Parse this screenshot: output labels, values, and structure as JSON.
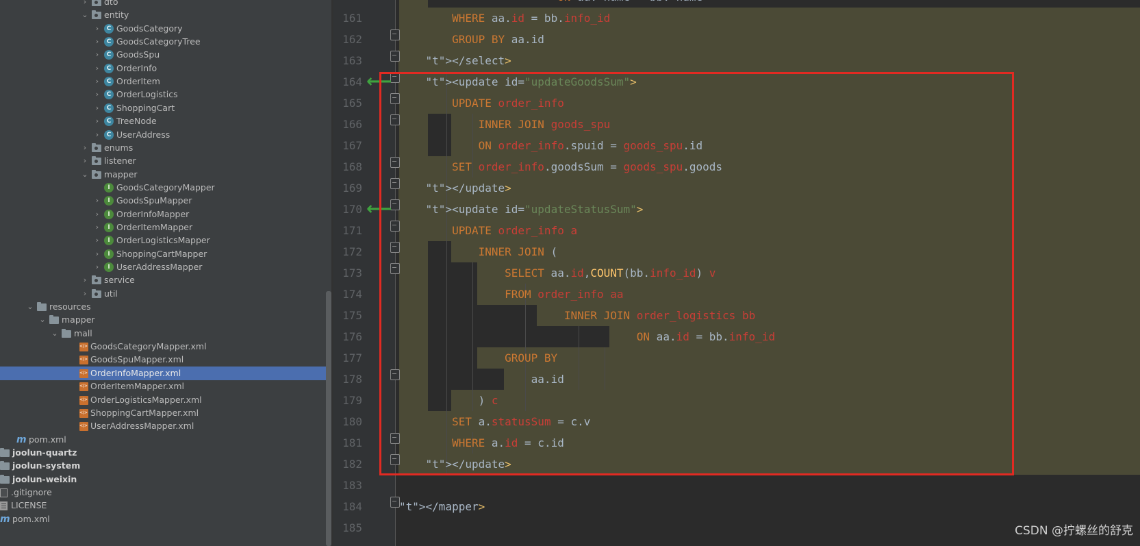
{
  "project_tree": {
    "rows": [
      {
        "label": "dto",
        "icon": "folder-icon",
        "expanded": false
      },
      {
        "label": "entity",
        "icon": "folder-icon",
        "expanded": true
      },
      {
        "label": "GoodsCategory",
        "icon": "class-icon"
      },
      {
        "label": "GoodsCategoryTree",
        "icon": "class-icon"
      },
      {
        "label": "GoodsSpu",
        "icon": "class-icon"
      },
      {
        "label": "OrderInfo",
        "icon": "class-icon"
      },
      {
        "label": "OrderItem",
        "icon": "class-icon"
      },
      {
        "label": "OrderLogistics",
        "icon": "class-icon"
      },
      {
        "label": "ShoppingCart",
        "icon": "class-icon"
      },
      {
        "label": "TreeNode",
        "icon": "class-icon"
      },
      {
        "label": "UserAddress",
        "icon": "class-icon"
      },
      {
        "label": "enums",
        "icon": "folder-icon"
      },
      {
        "label": "listener",
        "icon": "folder-icon"
      },
      {
        "label": "mapper",
        "icon": "folder-icon",
        "expanded": true
      },
      {
        "label": "GoodsCategoryMapper",
        "icon": "interface-icon"
      },
      {
        "label": "GoodsSpuMapper",
        "icon": "interface-icon"
      },
      {
        "label": "OrderInfoMapper",
        "icon": "interface-icon"
      },
      {
        "label": "OrderItemMapper",
        "icon": "interface-icon"
      },
      {
        "label": "OrderLogisticsMapper",
        "icon": "interface-icon"
      },
      {
        "label": "ShoppingCartMapper",
        "icon": "interface-icon"
      },
      {
        "label": "UserAddressMapper",
        "icon": "interface-icon"
      },
      {
        "label": "service",
        "icon": "folder-icon"
      },
      {
        "label": "util",
        "icon": "folder-icon"
      },
      {
        "label": "resources",
        "icon": "folder-icon",
        "expanded": true
      },
      {
        "label": "mapper",
        "icon": "folder-icon",
        "expanded": true
      },
      {
        "label": "mall",
        "icon": "folder-icon",
        "expanded": true
      },
      {
        "label": "GoodsCategoryMapper.xml",
        "icon": "xml-file-icon"
      },
      {
        "label": "GoodsSpuMapper.xml",
        "icon": "xml-file-icon"
      },
      {
        "label": "OrderInfoMapper.xml",
        "icon": "xml-file-icon",
        "selected": true
      },
      {
        "label": "OrderItemMapper.xml",
        "icon": "xml-file-icon"
      },
      {
        "label": "OrderLogisticsMapper.xml",
        "icon": "xml-file-icon"
      },
      {
        "label": "ShoppingCartMapper.xml",
        "icon": "xml-file-icon"
      },
      {
        "label": "UserAddressMapper.xml",
        "icon": "xml-file-icon"
      },
      {
        "label": "pom.xml",
        "icon": "maven-icon"
      },
      {
        "label": "joolun-quartz",
        "icon": "module-folder-icon"
      },
      {
        "label": "joolun-system",
        "icon": "module-folder-icon"
      },
      {
        "label": "joolun-weixin",
        "icon": "module-folder-icon"
      },
      {
        "label": ".gitignore",
        "icon": "text-file-icon"
      },
      {
        "label": "LICENSE",
        "icon": "text-file-icon"
      },
      {
        "label": "pom.xml",
        "icon": "maven-icon"
      }
    ]
  },
  "editor": {
    "lines": [
      {
        "num": "161",
        "text": "        WHERE aa.id = bb.info_id"
      },
      {
        "num": "162",
        "text": "        GROUP BY aa.id"
      },
      {
        "num": "163",
        "text": "    </select>"
      },
      {
        "num": "164",
        "text": "    <update id=\"updateGoodsSum\">"
      },
      {
        "num": "165",
        "text": "        UPDATE order_info"
      },
      {
        "num": "166",
        "text": "            INNER JOIN goods_spu"
      },
      {
        "num": "167",
        "text": "            ON order_info.spuid = goods_spu.id"
      },
      {
        "num": "168",
        "text": "        SET order_info.goodsSum = goods_spu.goods"
      },
      {
        "num": "169",
        "text": "    </update>"
      },
      {
        "num": "170",
        "text": "    <update id=\"updateStatusSum\">"
      },
      {
        "num": "171",
        "text": "        UPDATE order_info a"
      },
      {
        "num": "172",
        "text": "            INNER JOIN ("
      },
      {
        "num": "173",
        "text": "                SELECT aa.id,COUNT(bb.info_id) v"
      },
      {
        "num": "174",
        "text": "                FROM order_info aa"
      },
      {
        "num": "175",
        "text": "                         INNER JOIN order_logistics bb"
      },
      {
        "num": "176",
        "text": "                                    ON aa.id = bb.info_id"
      },
      {
        "num": "177",
        "text": "                GROUP BY"
      },
      {
        "num": "178",
        "text": "                    aa.id"
      },
      {
        "num": "179",
        "text": "            ) c"
      },
      {
        "num": "180",
        "text": "        SET a.statusSum = c.v"
      },
      {
        "num": "181",
        "text": "        WHERE a.id = c.id"
      },
      {
        "num": "182",
        "text": "    </update>"
      },
      {
        "num": "183",
        "text": ""
      },
      {
        "num": "184",
        "text": "</mapper>"
      },
      {
        "num": "185",
        "text": ""
      }
    ],
    "partial_top_line": "                        ON aa. name = bb. name"
  },
  "colors": {
    "keyword": "#cc7832",
    "tag": "#e8bf6a",
    "string": "#6a8759",
    "table": "#c93e36",
    "highlight": "#4b4a36",
    "annotation_box": "#e22a22"
  },
  "watermark": "CSDN @拧螺丝的舒克"
}
